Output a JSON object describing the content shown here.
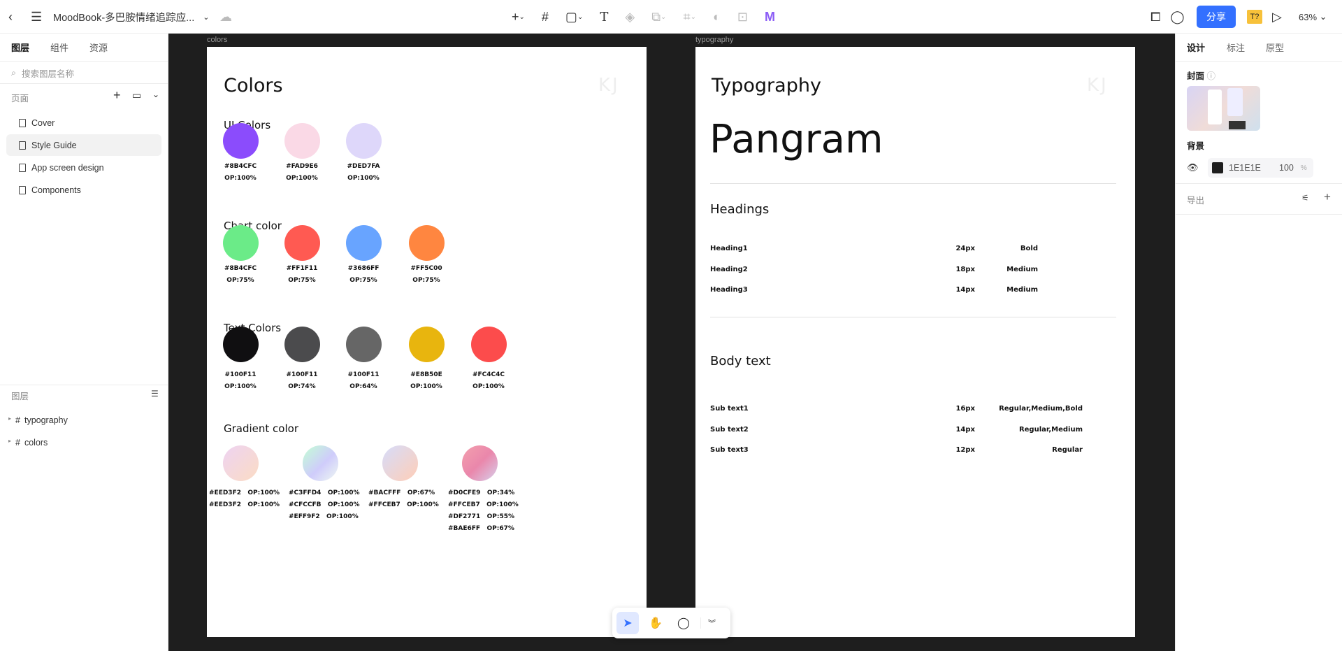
{
  "topbar": {
    "title": "MoodBook-多巴胺情绪追踪应...",
    "share": "分享",
    "zoom": "63%",
    "badge": "T?"
  },
  "left": {
    "tabs": [
      "图层",
      "组件",
      "资源"
    ],
    "search_placeholder": "搜索图层名称",
    "pages_label": "页面",
    "pages": [
      "Cover",
      "Style Guide",
      "App screen design",
      "Components"
    ],
    "layers_label": "图层",
    "layers": [
      "typography",
      "colors"
    ]
  },
  "right": {
    "tabs": [
      "设计",
      "标注",
      "原型"
    ],
    "cover_label": "封面",
    "bg_label": "背景",
    "bg_hex": "1E1E1E",
    "bg_opacity": "100",
    "pct": "%",
    "export_label": "导出"
  },
  "canvas": {
    "colors_label": "colors",
    "typography_label": "typography"
  },
  "colors": {
    "title": "Colors",
    "mark": "KJ",
    "ui_title": "UI Colors",
    "ui": [
      {
        "color": "#8B4CFC",
        "hex": "#8B4CFC",
        "op": "OP:100%"
      },
      {
        "color": "#FAD9E6",
        "hex": "#FAD9E6",
        "op": "OP:100%"
      },
      {
        "color": "#DED7FA",
        "hex": "#DED7FA",
        "op": "OP:100%"
      }
    ],
    "chart_title": "Chart color",
    "chart": [
      {
        "color": "#6BEB88",
        "hex": "#8B4CFC",
        "op": "OP:75%"
      },
      {
        "color": "#FF5A52",
        "hex": "#FF1F11",
        "op": "OP:75%"
      },
      {
        "color": "#68A4FF",
        "hex": "#3686FF",
        "op": "OP:75%"
      },
      {
        "color": "#FF8640",
        "hex": "#FF5C00",
        "op": "OP:75%"
      }
    ],
    "text_title": "Text Colors",
    "text": [
      {
        "color": "#100F11",
        "hex": "#100F11",
        "op": "OP:100%"
      },
      {
        "color": "#4B4B4D",
        "hex": "#100F11",
        "op": "OP:74%"
      },
      {
        "color": "#666666",
        "hex": "#100F11",
        "op": "OP:64%"
      },
      {
        "color": "#E8B50E",
        "hex": "#E8B50E",
        "op": "OP:100%"
      },
      {
        "color": "#FC4C4C",
        "hex": "#FC4C4C",
        "op": "OP:100%"
      }
    ],
    "grad_title": "Gradient color",
    "gradients": [
      {
        "css": "linear-gradient(135deg,#EED3F2,#FBDCC4)",
        "lines": [
          "#EED3F2   OP:100%",
          "#EED3F2   OP:100%"
        ]
      },
      {
        "css": "linear-gradient(135deg,#C3FFD4,#CFCCFB 55%,#EFF9F2)",
        "lines": [
          "#C3FFD4   OP:100%",
          "#CFCCFB   OP:100%",
          "#EFF9F2   OP:100%"
        ]
      },
      {
        "css": "linear-gradient(135deg,#D6DCFA,#FFCEB7)",
        "lines": [
          "#BACFFF   OP:67%",
          "#FFCEB7   OP:100%"
        ]
      },
      {
        "css": "linear-gradient(135deg,#F3A0AE,#EA87AB 50%,#D7D0EC)",
        "lines": [
          "#D0CFE9   OP:34%",
          "#FFCEB7   OP:100%",
          "#DF2771   OP:55%",
          "#BAE6FF   OP:67%"
        ]
      }
    ]
  },
  "typography": {
    "title": "Typography",
    "mark": "KJ",
    "pangram": "Pangram",
    "headings_title": "Headings",
    "headings": [
      {
        "name": "Heading1",
        "size": "24px",
        "weight": "Bold"
      },
      {
        "name": "Heading2",
        "size": "18px",
        "weight": "Medium"
      },
      {
        "name": "Heading3",
        "size": "14px",
        "weight": "Medium"
      }
    ],
    "body_title": "Body text",
    "body": [
      {
        "name": "Sub text1",
        "size": "16px",
        "weight": "Regular,Medium,Bold"
      },
      {
        "name": "Sub text2",
        "size": "14px",
        "weight": "Regular,Medium"
      },
      {
        "name": "Sub text3",
        "size": "12px",
        "weight": "Regular"
      }
    ]
  },
  "help": "?"
}
